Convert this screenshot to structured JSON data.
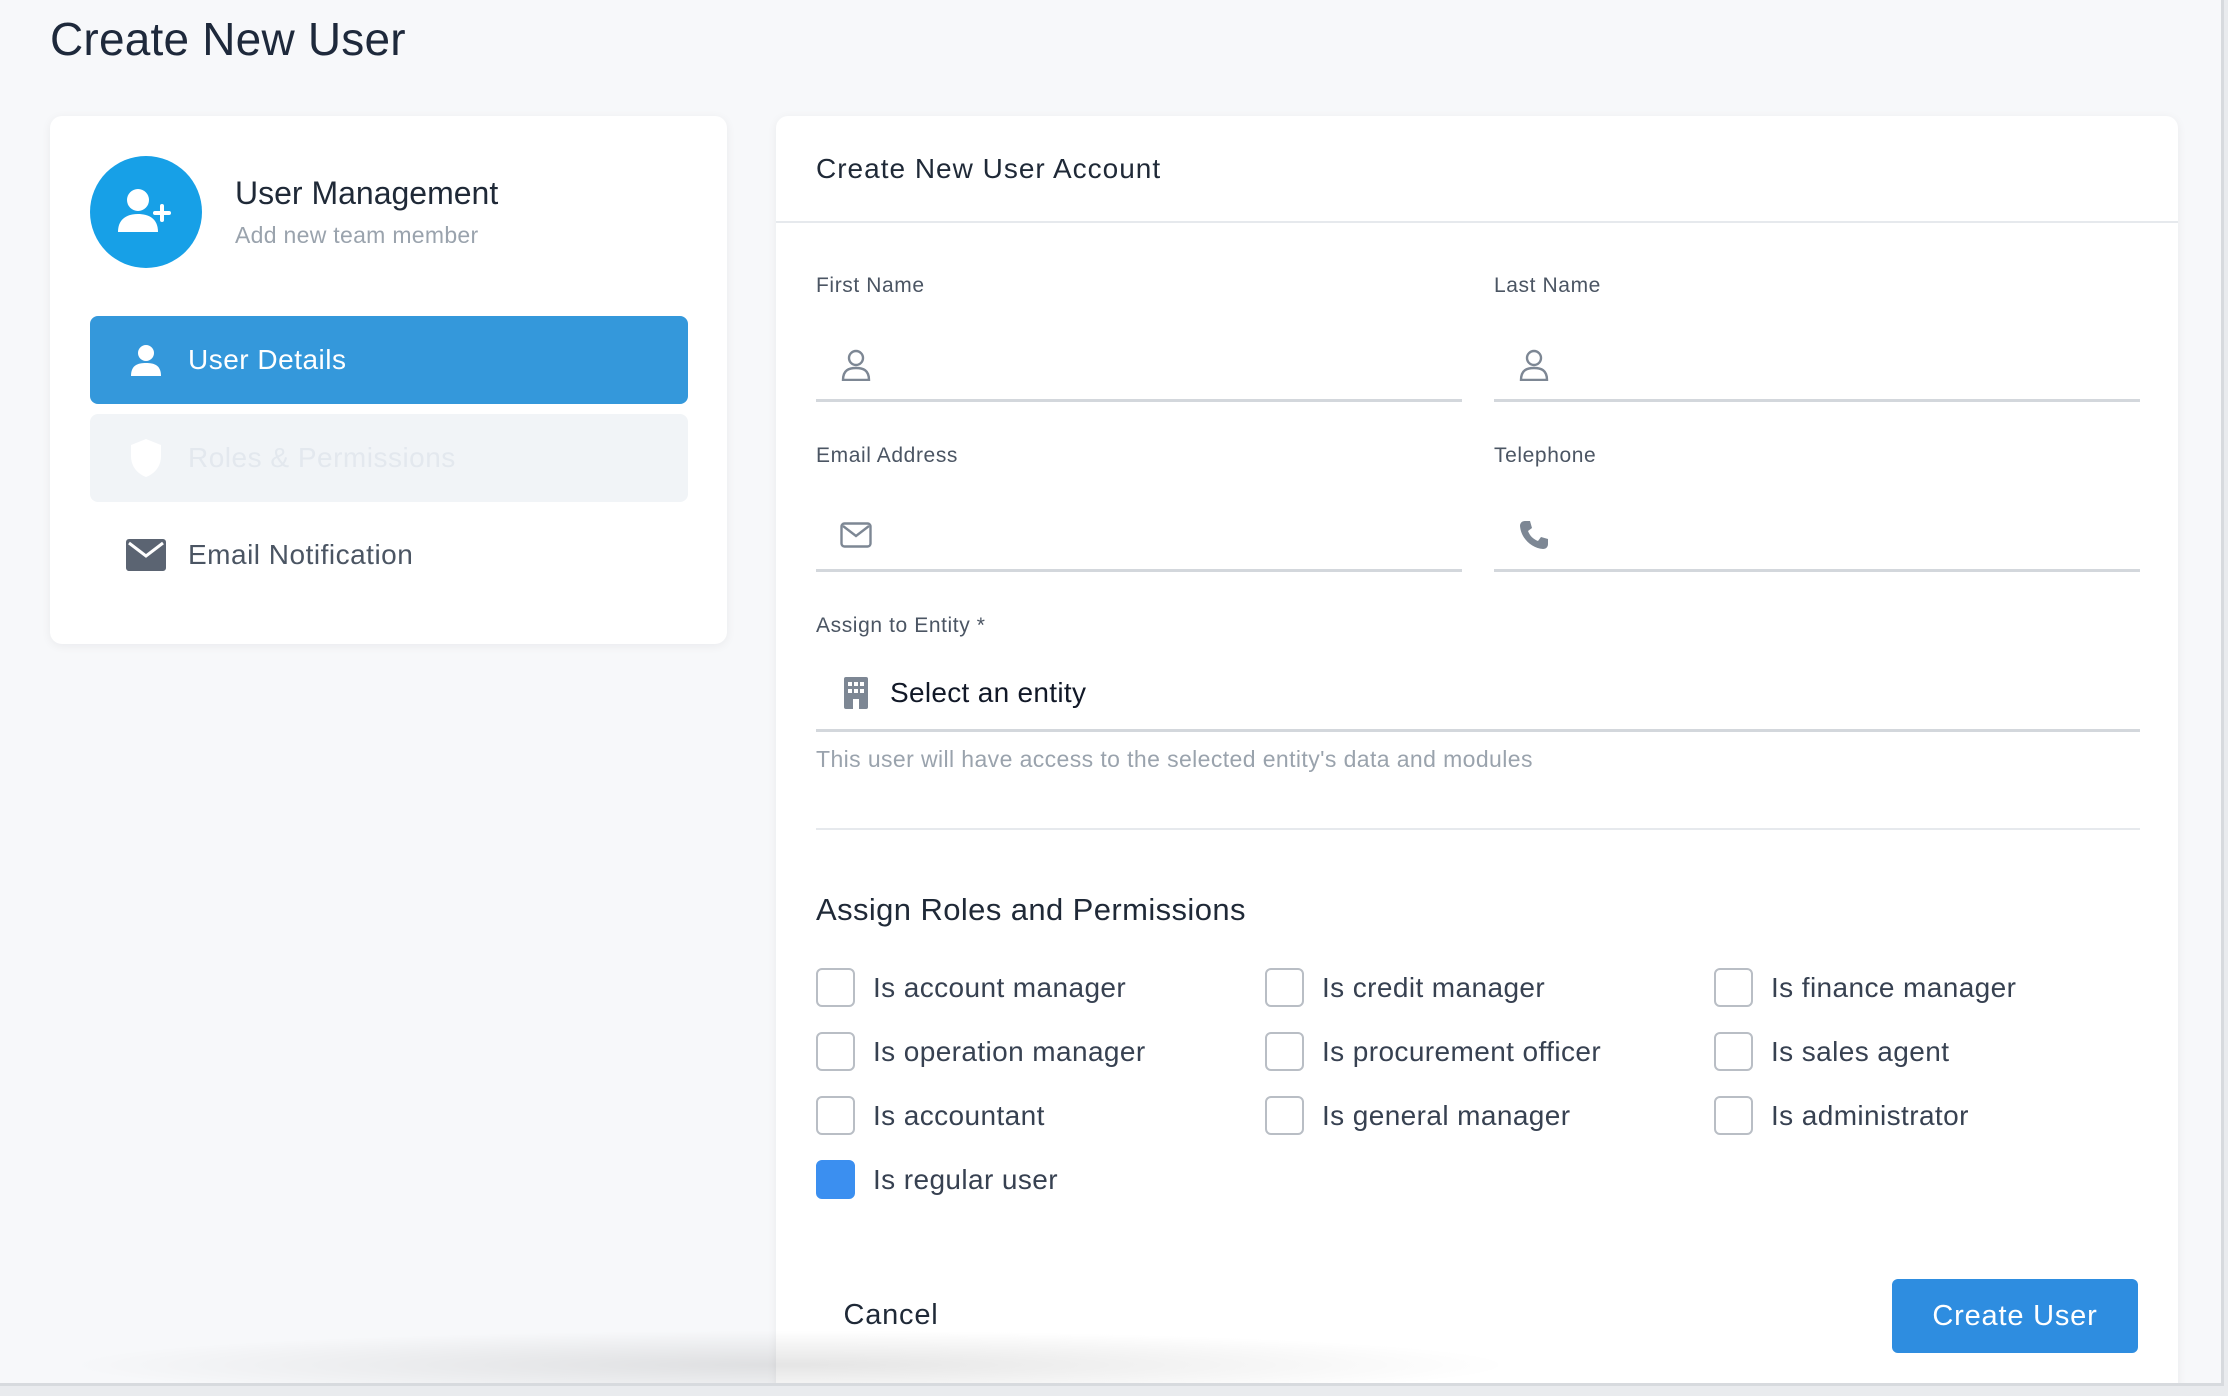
{
  "page": {
    "title": "Create New User"
  },
  "sidebar": {
    "title": "User Management",
    "subtitle": "Add new team member",
    "items": [
      {
        "label": "User Details",
        "icon": "user-icon",
        "state": "active"
      },
      {
        "label": "Roles & Permissions",
        "icon": "shield-icon",
        "state": "disabled"
      },
      {
        "label": "Email Notification",
        "icon": "mail-icon",
        "state": "default"
      }
    ]
  },
  "form": {
    "title": "Create New User Account",
    "first_name": {
      "label": "First Name",
      "value": "",
      "icon": "user-outline-icon"
    },
    "last_name": {
      "label": "Last Name",
      "value": "",
      "icon": "user-outline-icon"
    },
    "email": {
      "label": "Email Address",
      "value": "",
      "icon": "mail-outline-icon"
    },
    "telephone": {
      "label": "Telephone",
      "value": "",
      "icon": "phone-icon"
    },
    "entity": {
      "label": "Assign to Entity *",
      "selected": "Select an entity",
      "icon": "building-icon",
      "helper": "This user will have access to the selected entity's data and modules"
    }
  },
  "roles": {
    "title": "Assign Roles and Permissions",
    "items": [
      {
        "label": "Is account manager",
        "checked": false
      },
      {
        "label": "Is credit manager",
        "checked": false
      },
      {
        "label": "Is finance manager",
        "checked": false
      },
      {
        "label": "Is operation manager",
        "checked": false
      },
      {
        "label": "Is procurement officer",
        "checked": false
      },
      {
        "label": "Is sales agent",
        "checked": false
      },
      {
        "label": "Is accountant",
        "checked": false
      },
      {
        "label": "Is general manager",
        "checked": false
      },
      {
        "label": "Is administrator",
        "checked": false
      },
      {
        "label": "Is regular user",
        "checked": true
      }
    ]
  },
  "actions": {
    "cancel_label": "Cancel",
    "submit_label": "Create User"
  },
  "colors": {
    "primary": "#3498db",
    "avatar": "#17a0e7",
    "checkbox_checked": "#3b8ff0",
    "button": "#2e8de0"
  }
}
